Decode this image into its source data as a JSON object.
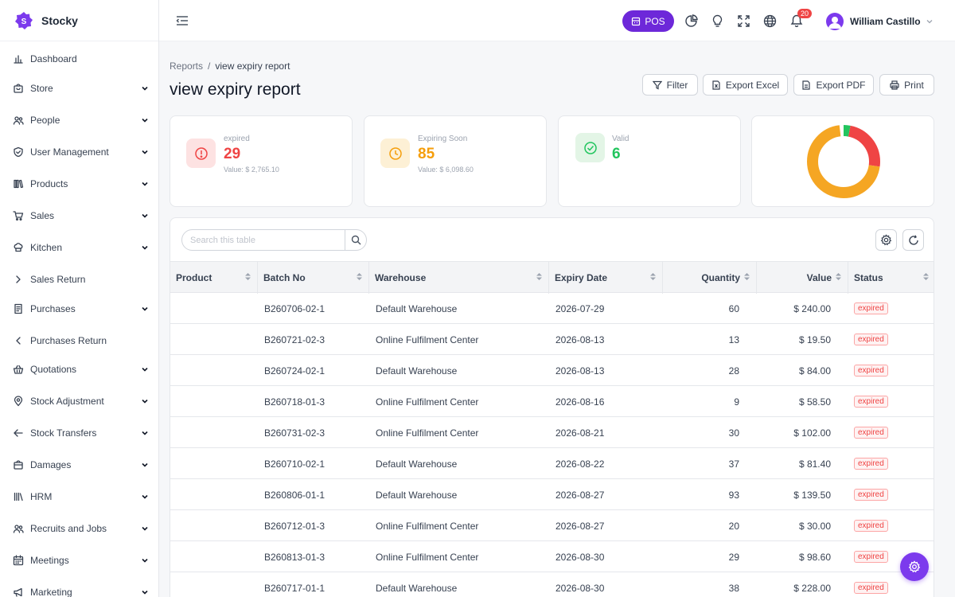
{
  "app": {
    "name": "Stocky"
  },
  "sidebar": {
    "items": [
      {
        "label": "Dashboard",
        "icon": "bar-chart-icon",
        "has_chevron": false
      },
      {
        "label": "Store",
        "icon": "store-bag-icon",
        "has_chevron": true
      },
      {
        "label": "People",
        "icon": "people-icon",
        "has_chevron": true
      },
      {
        "label": "User Management",
        "icon": "shield-check-icon",
        "has_chevron": true
      },
      {
        "label": "Products",
        "icon": "books-icon",
        "has_chevron": true
      },
      {
        "label": "Sales",
        "icon": "cart-icon",
        "has_chevron": true
      },
      {
        "label": "Kitchen",
        "icon": "chef-hat-icon",
        "has_chevron": true
      },
      {
        "label": "Sales Return",
        "icon": "chevron-right-icon",
        "has_chevron": false
      },
      {
        "label": "Purchases",
        "icon": "receipt-icon",
        "has_chevron": true
      },
      {
        "label": "Purchases Return",
        "icon": "chevron-left-icon",
        "has_chevron": false
      },
      {
        "label": "Quotations",
        "icon": "basket-icon",
        "has_chevron": true
      },
      {
        "label": "Stock Adjustment",
        "icon": "map-pin-icon",
        "has_chevron": true
      },
      {
        "label": "Stock Transfers",
        "icon": "arrow-left-icon",
        "has_chevron": true
      },
      {
        "label": "Damages",
        "icon": "bag-icon",
        "has_chevron": true
      },
      {
        "label": "HRM",
        "icon": "library-icon",
        "has_chevron": true
      },
      {
        "label": "Recruits and Jobs",
        "icon": "users-icon",
        "has_chevron": true
      },
      {
        "label": "Meetings",
        "icon": "calendar-icon",
        "has_chevron": true
      },
      {
        "label": "Marketing",
        "icon": "megaphone-icon",
        "has_chevron": true
      }
    ]
  },
  "header": {
    "pos_label": "POS",
    "notification_count": "20",
    "user_name": "William Castillo"
  },
  "breadcrumb": {
    "parent": "Reports",
    "separator": "/",
    "current": "view expiry report"
  },
  "page": {
    "title": "view expiry report"
  },
  "actions": {
    "filter": "Filter",
    "export_excel": "Export Excel",
    "export_pdf": "Export PDF",
    "print": "Print"
  },
  "cards": {
    "expired": {
      "label": "expired",
      "count": "29",
      "value": "Value: $ 2,765.10",
      "color": "#ef4444"
    },
    "expiring": {
      "label": "Expiring Soon",
      "count": "85",
      "value": "Value: $ 6,098.60",
      "color": "#f59e0b"
    },
    "valid": {
      "label": "Valid",
      "count": "6",
      "color": "#22c55e"
    }
  },
  "donut": {
    "segments": [
      {
        "label": "expired",
        "value": 29,
        "color": "#ef4444"
      },
      {
        "label": "Expiring Soon",
        "value": 85,
        "color": "#f5a623"
      },
      {
        "label": "Valid",
        "value": 6,
        "color": "#22c55e"
      }
    ]
  },
  "table": {
    "search_placeholder": "Search this table",
    "columns": [
      "Product",
      "Batch No",
      "Warehouse",
      "Expiry Date",
      "Quantity",
      "Value",
      "Status"
    ],
    "rows": [
      {
        "product": "",
        "batch": "B260706-02-1",
        "warehouse": "Default Warehouse",
        "expiry": "2026-07-29",
        "qty": "60",
        "value": "$ 240.00",
        "status": "expired"
      },
      {
        "product": "",
        "batch": "B260721-02-3",
        "warehouse": "Online Fulfilment Center",
        "expiry": "2026-08-13",
        "qty": "13",
        "value": "$ 19.50",
        "status": "expired"
      },
      {
        "product": "",
        "batch": "B260724-02-1",
        "warehouse": "Default Warehouse",
        "expiry": "2026-08-13",
        "qty": "28",
        "value": "$ 84.00",
        "status": "expired"
      },
      {
        "product": "",
        "batch": "B260718-01-3",
        "warehouse": "Online Fulfilment Center",
        "expiry": "2026-08-16",
        "qty": "9",
        "value": "$ 58.50",
        "status": "expired"
      },
      {
        "product": "",
        "batch": "B260731-02-3",
        "warehouse": "Online Fulfilment Center",
        "expiry": "2026-08-21",
        "qty": "30",
        "value": "$ 102.00",
        "status": "expired"
      },
      {
        "product": "",
        "batch": "B260710-02-1",
        "warehouse": "Default Warehouse",
        "expiry": "2026-08-22",
        "qty": "37",
        "value": "$ 81.40",
        "status": "expired"
      },
      {
        "product": "",
        "batch": "B260806-01-1",
        "warehouse": "Default Warehouse",
        "expiry": "2026-08-27",
        "qty": "93",
        "value": "$ 139.50",
        "status": "expired"
      },
      {
        "product": "",
        "batch": "B260712-01-3",
        "warehouse": "Online Fulfilment Center",
        "expiry": "2026-08-27",
        "qty": "20",
        "value": "$ 30.00",
        "status": "expired"
      },
      {
        "product": "",
        "batch": "B260813-01-3",
        "warehouse": "Online Fulfilment Center",
        "expiry": "2026-08-30",
        "qty": "29",
        "value": "$ 98.60",
        "status": "expired"
      },
      {
        "product": "",
        "batch": "B260717-01-1",
        "warehouse": "Default Warehouse",
        "expiry": "2026-08-30",
        "qty": "38",
        "value": "$ 228.00",
        "status": "expired"
      }
    ]
  },
  "theme": {
    "accent": "#7c3aed"
  }
}
